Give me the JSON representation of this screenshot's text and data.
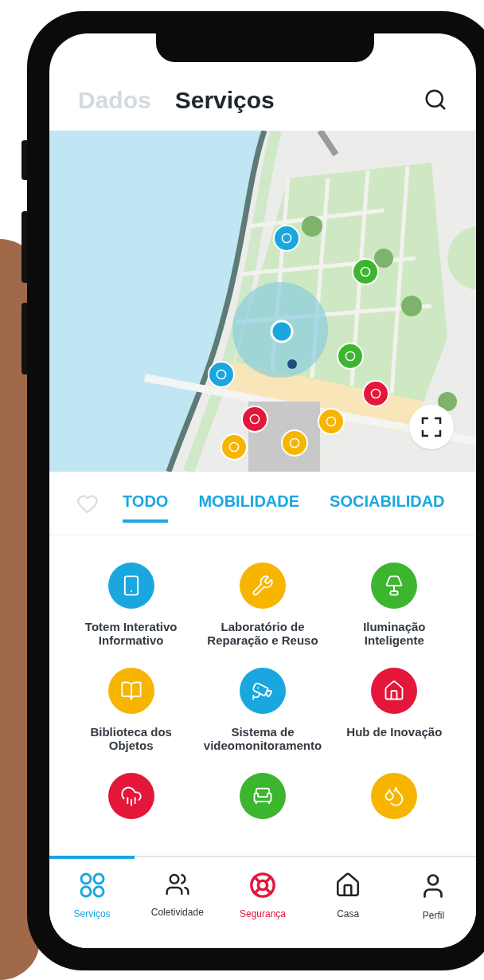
{
  "header": {
    "tabs": [
      {
        "label": "Dados",
        "selected": false
      },
      {
        "label": "Serviços",
        "selected": true
      }
    ]
  },
  "categories": {
    "favorite": false,
    "tabs": [
      {
        "label": "TODO",
        "selected": true
      },
      {
        "label": "MOBILIDADE",
        "selected": false
      },
      {
        "label": "SOCIABILIDAD",
        "selected": false
      }
    ]
  },
  "services": [
    {
      "kind": "kiosk",
      "label": "Totem Interativo Informativo",
      "color": "#1aa7e0"
    },
    {
      "kind": "repair",
      "label": "Laboratório de Reparação e Reuso",
      "color": "#f7b500"
    },
    {
      "kind": "light",
      "label": "Iluminação Inteligente",
      "color": "#3cb52f"
    },
    {
      "kind": "library",
      "label": "Biblioteca dos Objetos",
      "color": "#f7b500"
    },
    {
      "kind": "camera",
      "label": "Sistema de videomonitoramento",
      "color": "#1aa7e0"
    },
    {
      "kind": "hub",
      "label": "Hub de Inovação",
      "color": "#e4163a"
    },
    {
      "kind": "cloud",
      "color": "#e4163a"
    },
    {
      "kind": "bench",
      "color": "#3cb52f"
    },
    {
      "kind": "fountain",
      "color": "#f7b500"
    }
  ],
  "nav": [
    {
      "kind": "grid",
      "label": "Serviços",
      "selected": true,
      "alert": false
    },
    {
      "kind": "people",
      "label": "Coletividade",
      "selected": false,
      "alert": false
    },
    {
      "kind": "lifebuoy",
      "label": "Segurança",
      "selected": false,
      "alert": true
    },
    {
      "kind": "home",
      "label": "Casa",
      "selected": false,
      "alert": false
    },
    {
      "kind": "user",
      "label": "Perfil",
      "selected": false,
      "alert": false
    }
  ]
}
